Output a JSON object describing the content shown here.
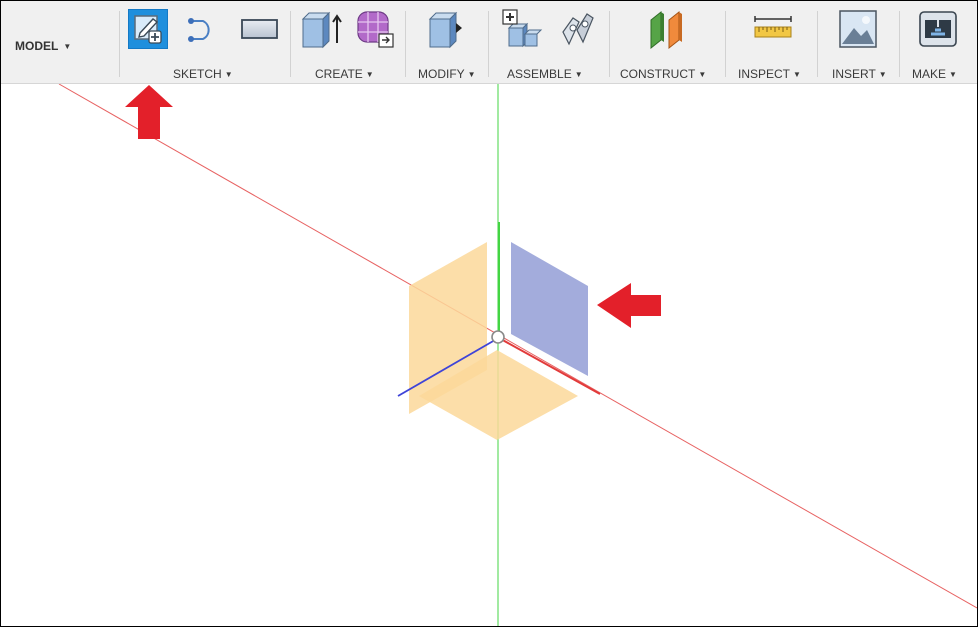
{
  "toolbar": {
    "workspace": {
      "label": "MODEL",
      "caret": "▼"
    },
    "groups": [
      {
        "id": "sketch",
        "label": "SKETCH",
        "caret": "▼",
        "tools": [
          "create-sketch-icon",
          "spline-icon",
          "rectangle-icon"
        ],
        "active_tool": "create-sketch-icon"
      },
      {
        "id": "create",
        "label": "CREATE",
        "caret": "▼",
        "tools": [
          "extrude-box-icon",
          "form-grid-icon"
        ]
      },
      {
        "id": "modify",
        "label": "MODIFY",
        "caret": "▼",
        "tools": [
          "press-pull-icon"
        ]
      },
      {
        "id": "assemble",
        "label": "ASSEMBLE",
        "caret": "▼",
        "tools": [
          "new-component-icon",
          "joint-icon"
        ]
      },
      {
        "id": "construct",
        "label": "CONSTRUCT",
        "caret": "▼",
        "tools": [
          "offset-plane-icon"
        ]
      },
      {
        "id": "inspect",
        "label": "INSPECT",
        "caret": "▼",
        "tools": [
          "measure-ruler-icon"
        ]
      },
      {
        "id": "insert",
        "label": "INSERT",
        "caret": "▼",
        "tools": [
          "insert-image-icon"
        ]
      },
      {
        "id": "make",
        "label": "MAKE",
        "caret": "▼",
        "tools": [
          "3d-print-icon"
        ]
      }
    ]
  },
  "viewport": {
    "planes": [
      "xy-plane",
      "yz-plane",
      "xz-plane"
    ],
    "highlighted_plane": "yz-plane",
    "colors": {
      "plane_orange": "#fcd89a",
      "plane_blue": "#a3acdc",
      "axis_red": "#e23b3b",
      "axis_green": "#43d543",
      "axis_blue": "#3f44d8",
      "annotation_arrow": "#e3202a"
    }
  }
}
